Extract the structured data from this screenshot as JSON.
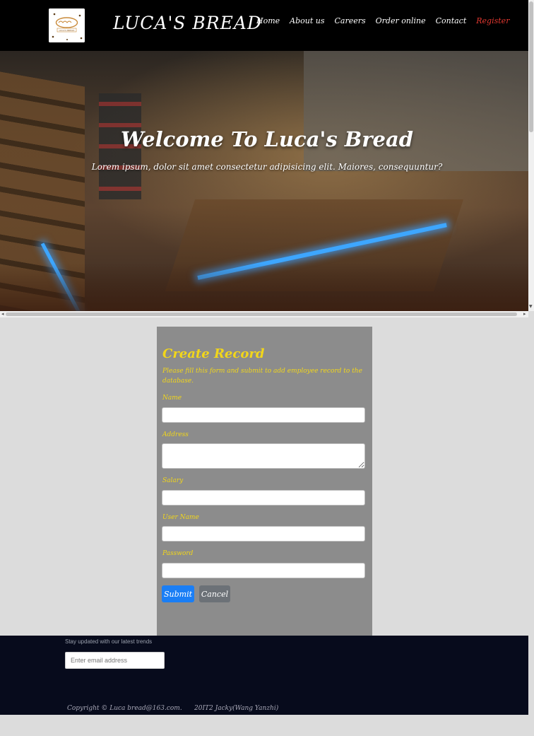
{
  "header": {
    "brand": "LUCA'S BREAD",
    "logo_text": "LUCA'S BREAD",
    "nav": [
      "Home",
      "About us",
      "Careers",
      "Order online",
      "Contact",
      "Register"
    ]
  },
  "hero": {
    "title": "Welcome To Luca's Bread",
    "subtitle": "Lorem ipsum, dolor sit amet consectetur adipisicing elit. Maiores, consequuntur?"
  },
  "form": {
    "title": "Create Record",
    "description": "Please fill this form and submit to add employee record to the database.",
    "fields": {
      "name": {
        "label": "Name",
        "value": ""
      },
      "address": {
        "label": "Address",
        "value": ""
      },
      "salary": {
        "label": "Salary",
        "value": ""
      },
      "username": {
        "label": "User Name",
        "value": ""
      },
      "password": {
        "label": "Password",
        "value": ""
      }
    },
    "submit_label": "Submit",
    "cancel_label": "Cancel"
  },
  "footer": {
    "newsletter_text": "Stay updated with our latest trends",
    "email_placeholder": "Enter email address",
    "copyright": "Copyright © Luca bread@163.com.",
    "credit": "20IT2 Jacky(Wang Yanzhi)"
  },
  "colors": {
    "header_bg": "#000000",
    "register_link": "#e0372f",
    "form_text": "#f2d61a",
    "panel_bg": "#8c8c8c",
    "submit_button": "#1a7ef5",
    "cancel_button": "#6c7177",
    "footer_bg": "#070b1c"
  }
}
